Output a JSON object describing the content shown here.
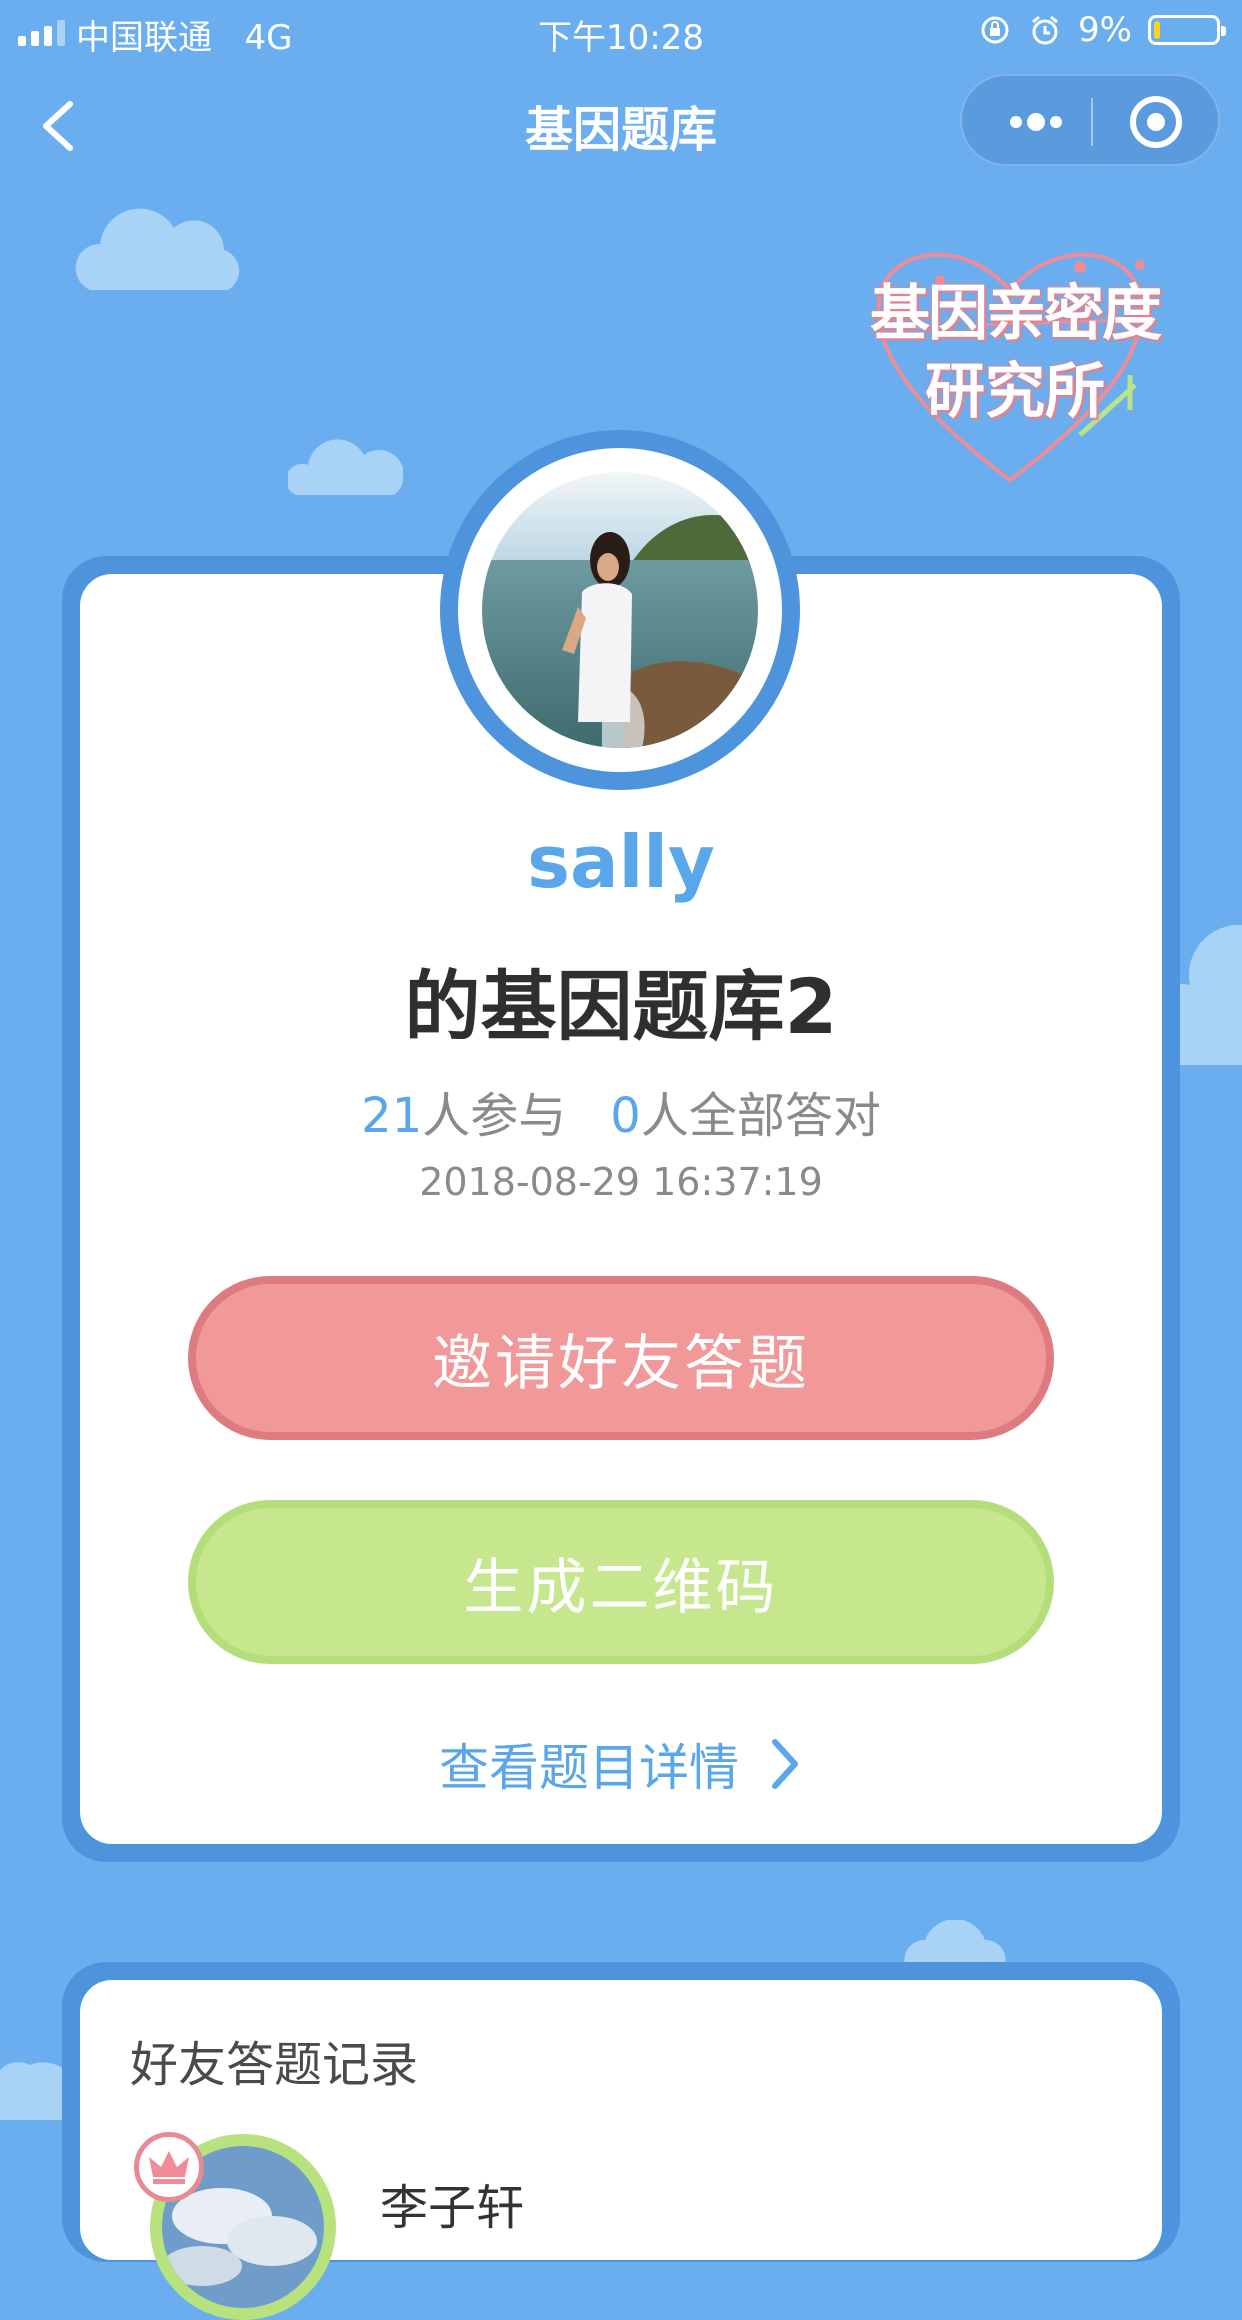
{
  "status_bar": {
    "carrier": "中国联通",
    "network": "4G",
    "time": "下午10:28",
    "battery": "9%",
    "battery_level": 0.09
  },
  "nav": {
    "title": "基因题库",
    "back_icon": "chevron-left-icon",
    "more_icon": "more-dots-icon",
    "close_icon": "target-close-icon"
  },
  "logo": {
    "line1": "基因亲密度",
    "line2": "研究所"
  },
  "profile": {
    "username": "sally",
    "bank_title": "的基因题库2",
    "participants_count": "21",
    "participants_label": "人参与",
    "all_correct_count": "0",
    "all_correct_label": "人全部答对",
    "date": "2018-08-29 16:37:19"
  },
  "actions": {
    "invite_label": "邀请好友答题",
    "qrcode_label": "生成二维码",
    "detail_label": "查看题目详情"
  },
  "records": {
    "title": "好友答题记录",
    "items": [
      {
        "name": "李子轩",
        "badge_icon": "crown-icon"
      }
    ]
  },
  "colors": {
    "background": "#6aaef0",
    "card_border": "#4e94dc",
    "accent_blue": "#5aa6ea",
    "invite_pink": "#f19898",
    "qrcode_green": "#c6e78e"
  }
}
